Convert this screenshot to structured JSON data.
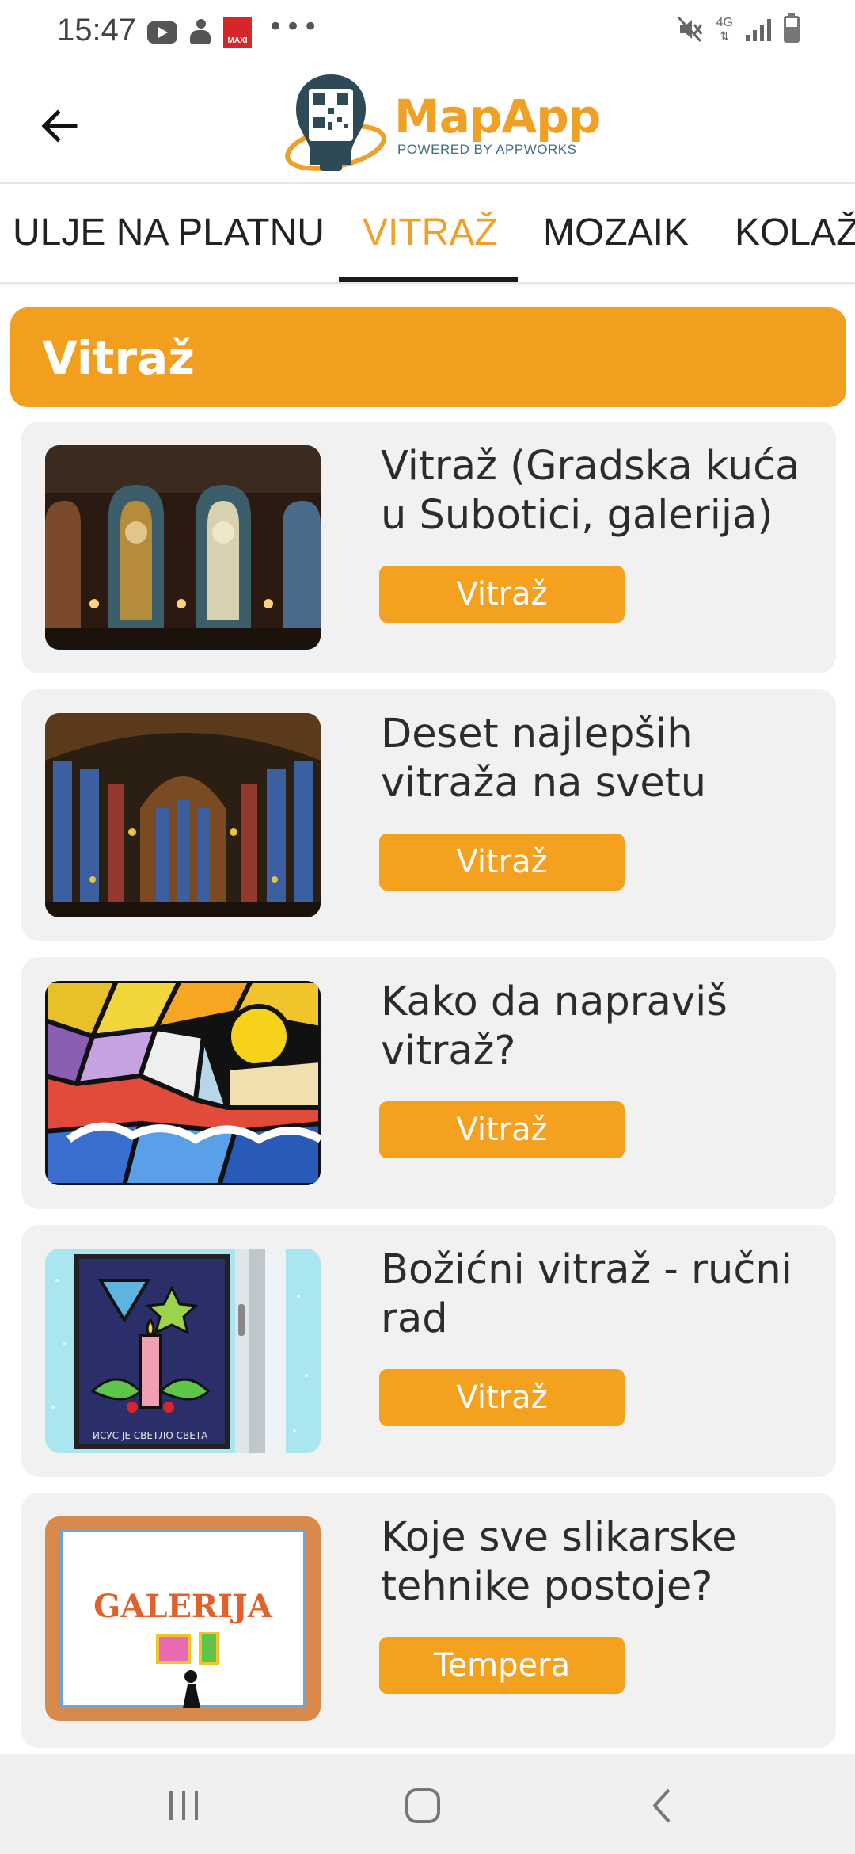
{
  "status_bar": {
    "time": "15:47",
    "notification_icons": [
      "youtube-icon",
      "person-icon",
      "maxi-app-icon",
      "more-dots-icon"
    ],
    "maxi_label": "MAXI",
    "dots": "•••",
    "right_icons": [
      "mute-icon",
      "network-4g-icon",
      "signal-icon",
      "battery-icon"
    ],
    "network_label": "4G"
  },
  "header": {
    "back_icon": "arrow-left-icon",
    "logo_title": "MapApp",
    "logo_subtitle": "POWERED BY APPWORKS"
  },
  "tabs": [
    {
      "label": "ULJE NA PLATNU",
      "active": false
    },
    {
      "label": "VITRAŽ",
      "active": true
    },
    {
      "label": "MOZAIK",
      "active": false
    },
    {
      "label": "KOLAŽ",
      "active": false
    }
  ],
  "section": {
    "title": "Vitraž"
  },
  "cards": [
    {
      "title": "Vitraž (Gradska kuća u Subotici, galerija)",
      "tag": "Vitraž"
    },
    {
      "title": "Deset najlepših vitraža na svetu",
      "tag": "Vitraž"
    },
    {
      "title": "Kako da napraviš vitraž?",
      "tag": "Vitraž"
    },
    {
      "title": "Božićni vitraž - ručni rad",
      "tag": "Vitraž"
    },
    {
      "title": "Koje sve slikarske tehnike postoje?",
      "tag": "Tempera",
      "thumb_text": "GALERIJA"
    }
  ],
  "thumb_caption_4": "ИСУС ЈЕ СВЕТЛО СВЕТА",
  "colors": {
    "accent": "#f0a125",
    "section_bg": "#f29e1f",
    "card_bg": "#f1f1f1",
    "button_bg": "#f4a11f"
  },
  "nav": [
    "recent-apps-icon",
    "home-icon",
    "back-icon"
  ]
}
